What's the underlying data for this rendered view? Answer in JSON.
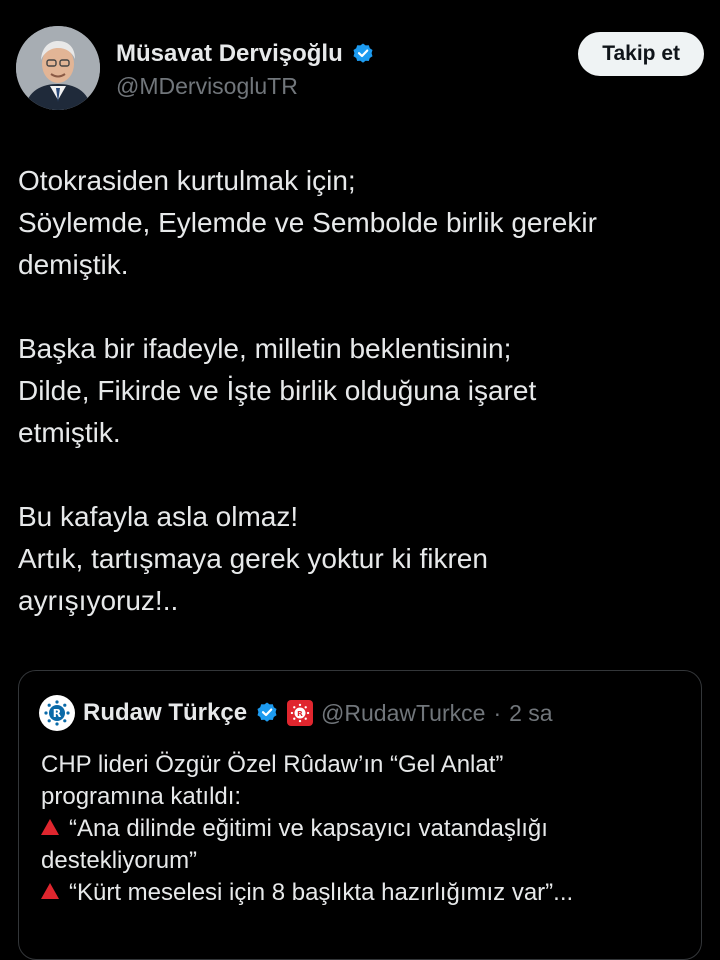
{
  "author": {
    "name": "Müsavat Dervişoğlu",
    "handle": "@MDervisogluTR",
    "verified_color": "#1d9bf0",
    "avatar_icon": "profile-photo"
  },
  "follow_button": {
    "label": "Takip et"
  },
  "tweet": {
    "paragraphs": [
      "Otokrasiden kurtulmak için;\nSöylemde, Eylemde ve Sembolde birlik gerekir\ndemiştik.",
      "Başka bir ifadeyle, milletin beklentisinin;\nDilde, Fikirde ve İşte birlik olduğuna işaret\netmiştik.",
      "Bu kafayla asla olmaz!\nArtık, tartışmaya gerek yoktur ki fikren\nayrışıyoruz!.."
    ]
  },
  "quote": {
    "name": "Rudaw Türkçe",
    "handle": "@RudawTurkce",
    "separator": "·",
    "time": "2 sa",
    "lines": [
      "CHP lideri Özgür Özel Rûdaw’ın “Gel Anlat”",
      "programına katıldı:",
      "“Ana dilinde eğitimi ve kapsayıcı vatandaşlığı",
      "destekliyorum”",
      "“Kürt meselesi için 8 başlıkta hazırlığımız var”..."
    ],
    "bullet_color": "#e0262e",
    "brand_color": "#e0262e"
  }
}
